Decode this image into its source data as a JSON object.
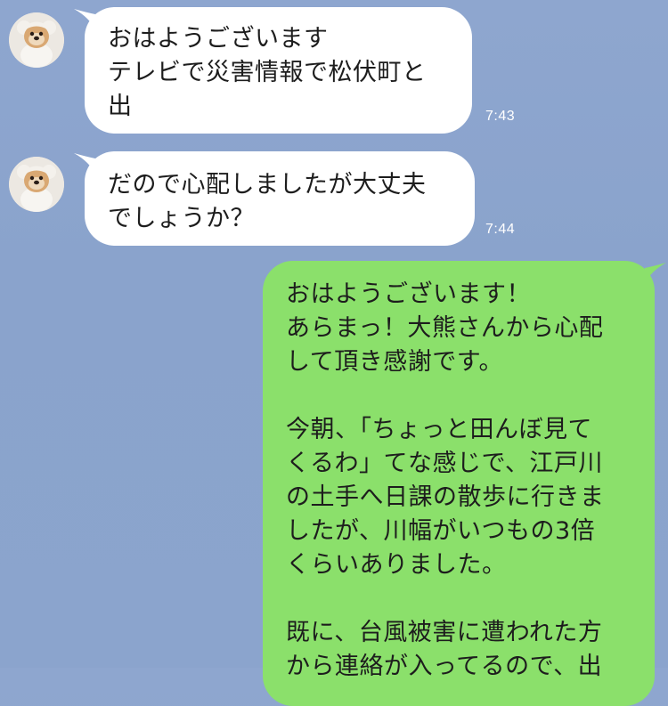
{
  "chat": {
    "messages": [
      {
        "sender": "in",
        "text": "おはようございます\nテレビで災害情報で松伏町と\n出",
        "time": "7:43"
      },
      {
        "sender": "in",
        "text": "だので心配しましたが大丈夫\nでしょうか？",
        "time": "7:44"
      },
      {
        "sender": "out",
        "text": "おはようございます！\nあらまっ！大熊さんから心配\nして頂き感謝です。\n\n今朝、「ちょっと田んぼ見て\nくるわ」てな感じで、江戸川\nの土手へ日課の散歩に行きま\nしたが、川幅がいつもの3倍\nくらいありました。\n\n既に、台風被害に遭われた方\nから連絡が入ってるので、出"
      }
    ]
  },
  "colors": {
    "background": "#8ea6cf",
    "incoming_bubble": "#ffffff",
    "outgoing_bubble": "#8be06b",
    "timestamp": "#ffffff"
  },
  "icons": {
    "avatar": "dog-avatar-icon"
  }
}
